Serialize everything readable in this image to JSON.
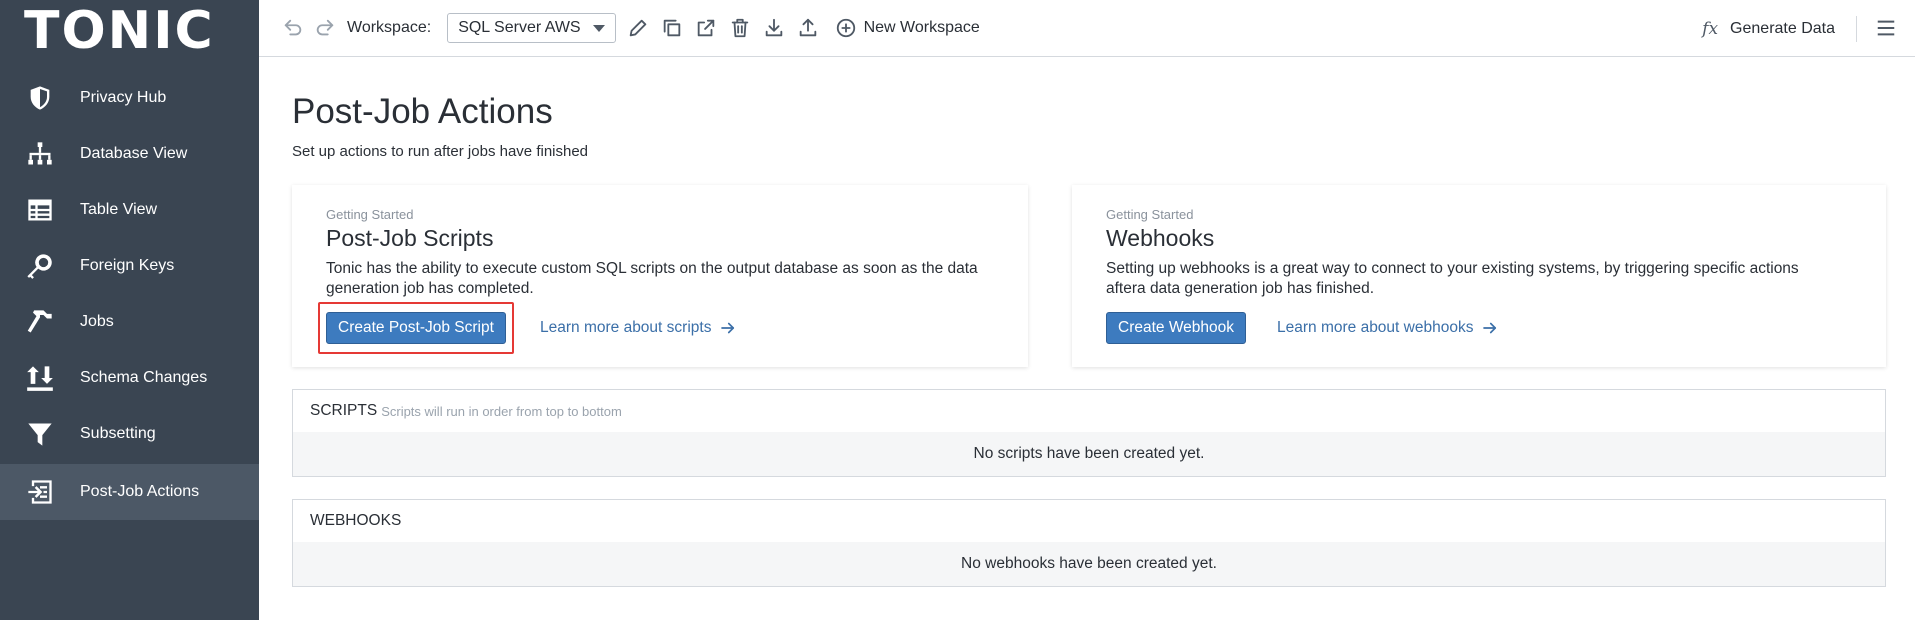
{
  "sidebar": {
    "logo": "TONIC",
    "items": [
      {
        "label": "Privacy Hub",
        "icon": "shield-icon"
      },
      {
        "label": "Database View",
        "icon": "hierarchy-icon"
      },
      {
        "label": "Table View",
        "icon": "table-icon"
      },
      {
        "label": "Foreign Keys",
        "icon": "key-icon"
      },
      {
        "label": "Jobs",
        "icon": "hammer-icon"
      },
      {
        "label": "Schema Changes",
        "icon": "sort-arrows-icon"
      },
      {
        "label": "Subsetting",
        "icon": "filter-icon"
      },
      {
        "label": "Post-Job Actions",
        "icon": "post-job-icon"
      }
    ],
    "active_item": "Post-Job Actions"
  },
  "toolbar": {
    "workspace_label": "Workspace:",
    "workspace_value": "SQL Server AWS",
    "new_workspace_label": "New Workspace",
    "generate_data_label": "Generate Data",
    "fx_symbol": "fx"
  },
  "page": {
    "title": "Post-Job Actions",
    "subtitle": "Set up actions to run after jobs have finished"
  },
  "cards": {
    "scripts": {
      "eyebrow": "Getting Started",
      "title": "Post-Job Scripts",
      "description_line1": "Tonic has the ability to execute custom SQL scripts on the output database as soon as the data",
      "description_line2": "generation job has completed.",
      "button_label": "Create Post-Job Script",
      "link_label": "Learn more about scripts"
    },
    "webhooks": {
      "eyebrow": "Getting Started",
      "title": "Webhooks",
      "description_line1": "Setting up webhooks is a great way to connect to your existing systems, by triggering specific actions",
      "description_line2": "aftera data generation job has finished.",
      "button_label": "Create Webhook",
      "link_label": "Learn more about webhooks"
    }
  },
  "panels": {
    "scripts": {
      "title": "SCRIPTS",
      "hint": "Scripts will run in order from top to bottom",
      "empty_text": "No scripts have been created yet."
    },
    "webhooks": {
      "title": "WEBHOOKS",
      "empty_text": "No webhooks have been created yet."
    }
  },
  "colors": {
    "sidebar_bg": "#3a4552",
    "sidebar_active_bg": "#4c5866",
    "primary_button": "#3d7bbf",
    "link": "#3b6fa8",
    "highlight": "#e53935"
  }
}
